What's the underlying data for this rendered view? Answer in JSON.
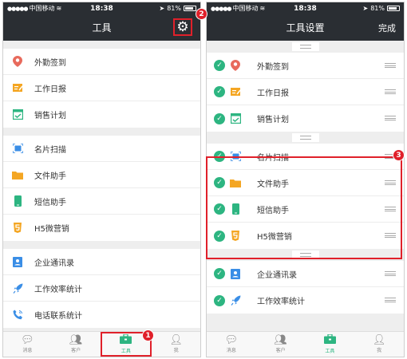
{
  "status_bar": {
    "carrier": "中国移动",
    "time": "18:38",
    "battery": "81%"
  },
  "left": {
    "title": "工具",
    "groups": [
      [
        {
          "label": "外勤签到",
          "icon": "location-pin-icon",
          "color": "#e86a5c"
        },
        {
          "label": "工作日报",
          "icon": "daily-report-icon",
          "color": "#f4a623"
        },
        {
          "label": "销售计划",
          "icon": "sales-plan-icon",
          "color": "#2db581"
        }
      ],
      [
        {
          "label": "名片扫描",
          "icon": "card-scan-icon",
          "color": "#3a8ee6"
        },
        {
          "label": "文件助手",
          "icon": "folder-icon",
          "color": "#f4a623"
        },
        {
          "label": "短信助手",
          "icon": "phone-icon",
          "color": "#2db581"
        },
        {
          "label": "H5微营销",
          "icon": "h5-icon",
          "color": "#f4a623"
        }
      ],
      [
        {
          "label": "企业通讯录",
          "icon": "contacts-icon",
          "color": "#3a8ee6"
        },
        {
          "label": "工作效率统计",
          "icon": "rocket-icon",
          "color": "#3a8ee6"
        },
        {
          "label": "电话联系统计",
          "icon": "phone-call-icon",
          "color": "#3a8ee6"
        }
      ]
    ]
  },
  "right": {
    "title": "工具设置",
    "done_label": "完成",
    "groups": [
      [
        {
          "label": "外勤签到",
          "icon": "location-pin-icon",
          "color": "#e86a5c"
        },
        {
          "label": "工作日报",
          "icon": "daily-report-icon",
          "color": "#f4a623"
        },
        {
          "label": "销售计划",
          "icon": "sales-plan-icon",
          "color": "#2db581"
        }
      ],
      [
        {
          "label": "名片扫描",
          "icon": "card-scan-icon",
          "color": "#3a8ee6"
        },
        {
          "label": "文件助手",
          "icon": "folder-icon",
          "color": "#f4a623"
        },
        {
          "label": "短信助手",
          "icon": "phone-icon",
          "color": "#2db581"
        },
        {
          "label": "H5微营销",
          "icon": "h5-icon",
          "color": "#f4a623"
        }
      ],
      [
        {
          "label": "企业通讯录",
          "icon": "contacts-icon",
          "color": "#3a8ee6"
        },
        {
          "label": "工作效率统计",
          "icon": "rocket-icon",
          "color": "#3a8ee6"
        }
      ]
    ]
  },
  "tabbar": [
    {
      "label": "消息",
      "icon": "chat-icon"
    },
    {
      "label": "客户",
      "icon": "customers-icon"
    },
    {
      "label": "工具",
      "icon": "toolbox-icon"
    },
    {
      "label": "我",
      "icon": "user-icon"
    }
  ],
  "active_tab": 2,
  "annotations": [
    "1",
    "2",
    "3"
  ],
  "accent_color": "#2db581",
  "highlight_color": "#e0202a"
}
